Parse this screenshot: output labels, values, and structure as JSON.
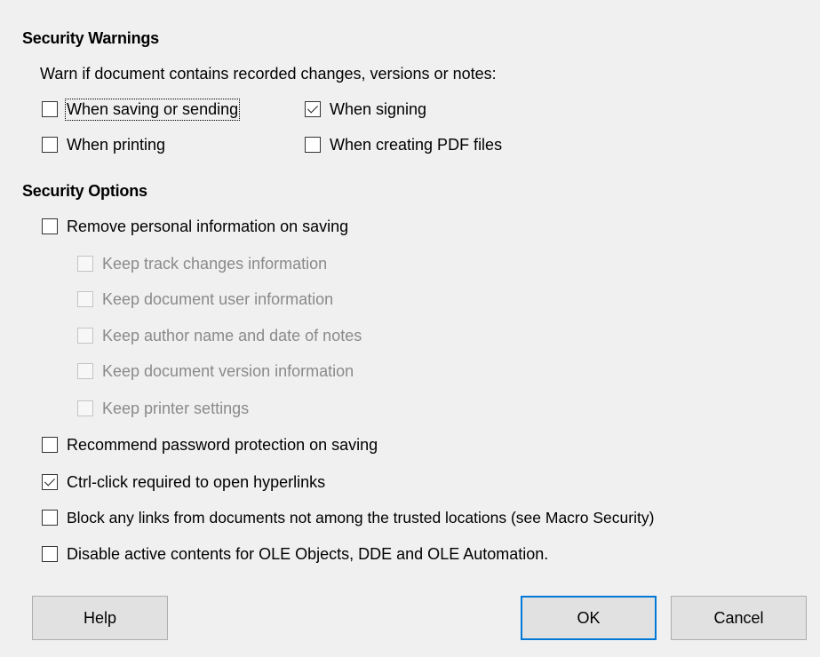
{
  "security_warnings": {
    "heading": "Security Warnings",
    "description": "Warn if document contains recorded changes, versions or notes:",
    "when_saving": {
      "label": "When saving or sending",
      "checked": false
    },
    "when_signing": {
      "label": "When signing",
      "checked": true
    },
    "when_printing": {
      "label": "When printing",
      "checked": false
    },
    "when_creating_pdf": {
      "label": "When creating PDF files",
      "checked": false
    }
  },
  "security_options": {
    "heading": "Security Options",
    "remove_personal_info": {
      "label": "Remove personal information on saving",
      "checked": false
    },
    "keep_track_changes": {
      "label": "Keep track changes information",
      "checked": false,
      "enabled": false
    },
    "keep_document_user": {
      "label": "Keep document user information",
      "checked": false,
      "enabled": false
    },
    "keep_author_name": {
      "label": "Keep author name and date of notes",
      "checked": false,
      "enabled": false
    },
    "keep_version_info": {
      "label": "Keep document version information",
      "checked": false,
      "enabled": false
    },
    "keep_printer_settings": {
      "label": "Keep printer settings",
      "checked": false,
      "enabled": false
    },
    "recommend_password": {
      "label": "Recommend password protection on saving",
      "checked": false
    },
    "ctrl_click": {
      "label": "Ctrl-click required to open hyperlinks",
      "checked": true
    },
    "block_links": {
      "label": "Block any links from documents not among the trusted locations (see Macro Security)",
      "checked": false
    },
    "disable_active_contents": {
      "label": "Disable active contents for OLE Objects, DDE and OLE Automation.",
      "checked": false
    }
  },
  "buttons": {
    "help": "Help",
    "ok": "OK",
    "cancel": "Cancel"
  }
}
